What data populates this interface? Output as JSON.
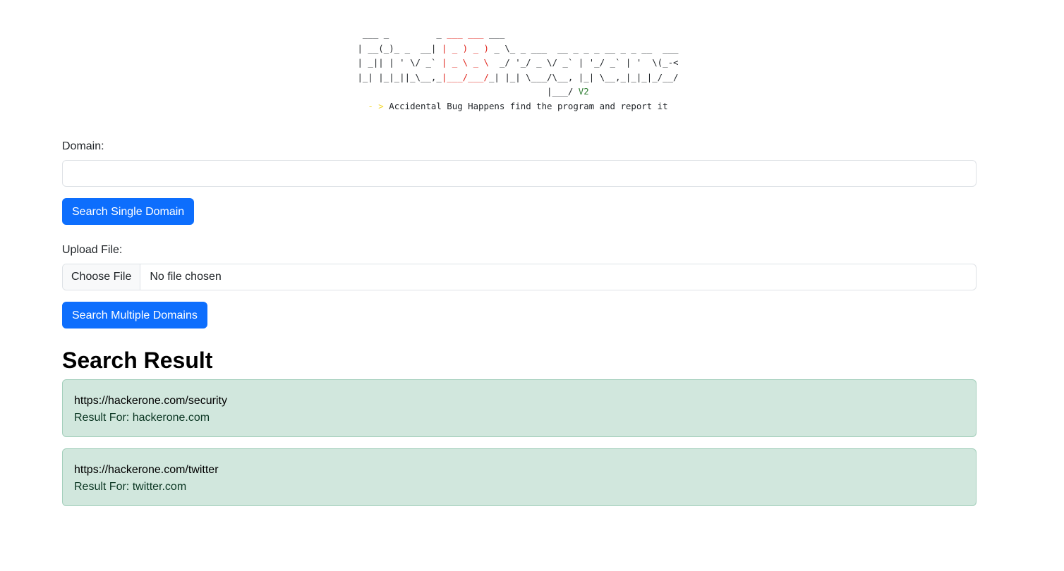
{
  "banner": {
    "line1_a": " ___ _         _ ",
    "line1_b": "___ ___",
    "line1_c": " ___",
    "line2_a": "| __(_)_ _  __| ",
    "line2_b": "| _ ) _ )",
    "line2_c": " _ \\_ _ ___  __ _ _ _ __ _ _ __  ___",
    "line3_a": "| _|| | ' \\/ _` ",
    "line3_b": "| _ \\ _ \\",
    "line3_c": "  _/ '_/ _ \\/ _` | '_/ _` | '  \\(_-<",
    "line4_a": "|_| |_|_||_\\__,_",
    "line4_b": "|___/___/",
    "line4_c": "_| |_| \\___/\\__, |_| \\__,_|_|_|_/__/",
    "line5_a": "                                    |___/ ",
    "line5_b": "V2",
    "line6_a": "  - > ",
    "line6_b": "Accidental Bug Happens find the program and report it"
  },
  "single": {
    "label": "Domain:",
    "value": "",
    "button": "Search Single Domain"
  },
  "multi": {
    "label": "Upload File:",
    "choose": "Choose File",
    "status": "No file chosen",
    "button": "Search Multiple Domains"
  },
  "results": {
    "title": "Search Result",
    "items": [
      {
        "url": "https://hackerone.com/security",
        "sub": "Result For: hackerone.com"
      },
      {
        "url": "https://hackerone.com/twitter",
        "sub": "Result For: twitter.com"
      }
    ]
  },
  "colors": {
    "primary": "#0d6efd",
    "success_bg": "#d1e7dd",
    "banner_red": "#e0241b",
    "banner_green": "#2e7d32",
    "banner_yellow": "#f3d72e"
  }
}
